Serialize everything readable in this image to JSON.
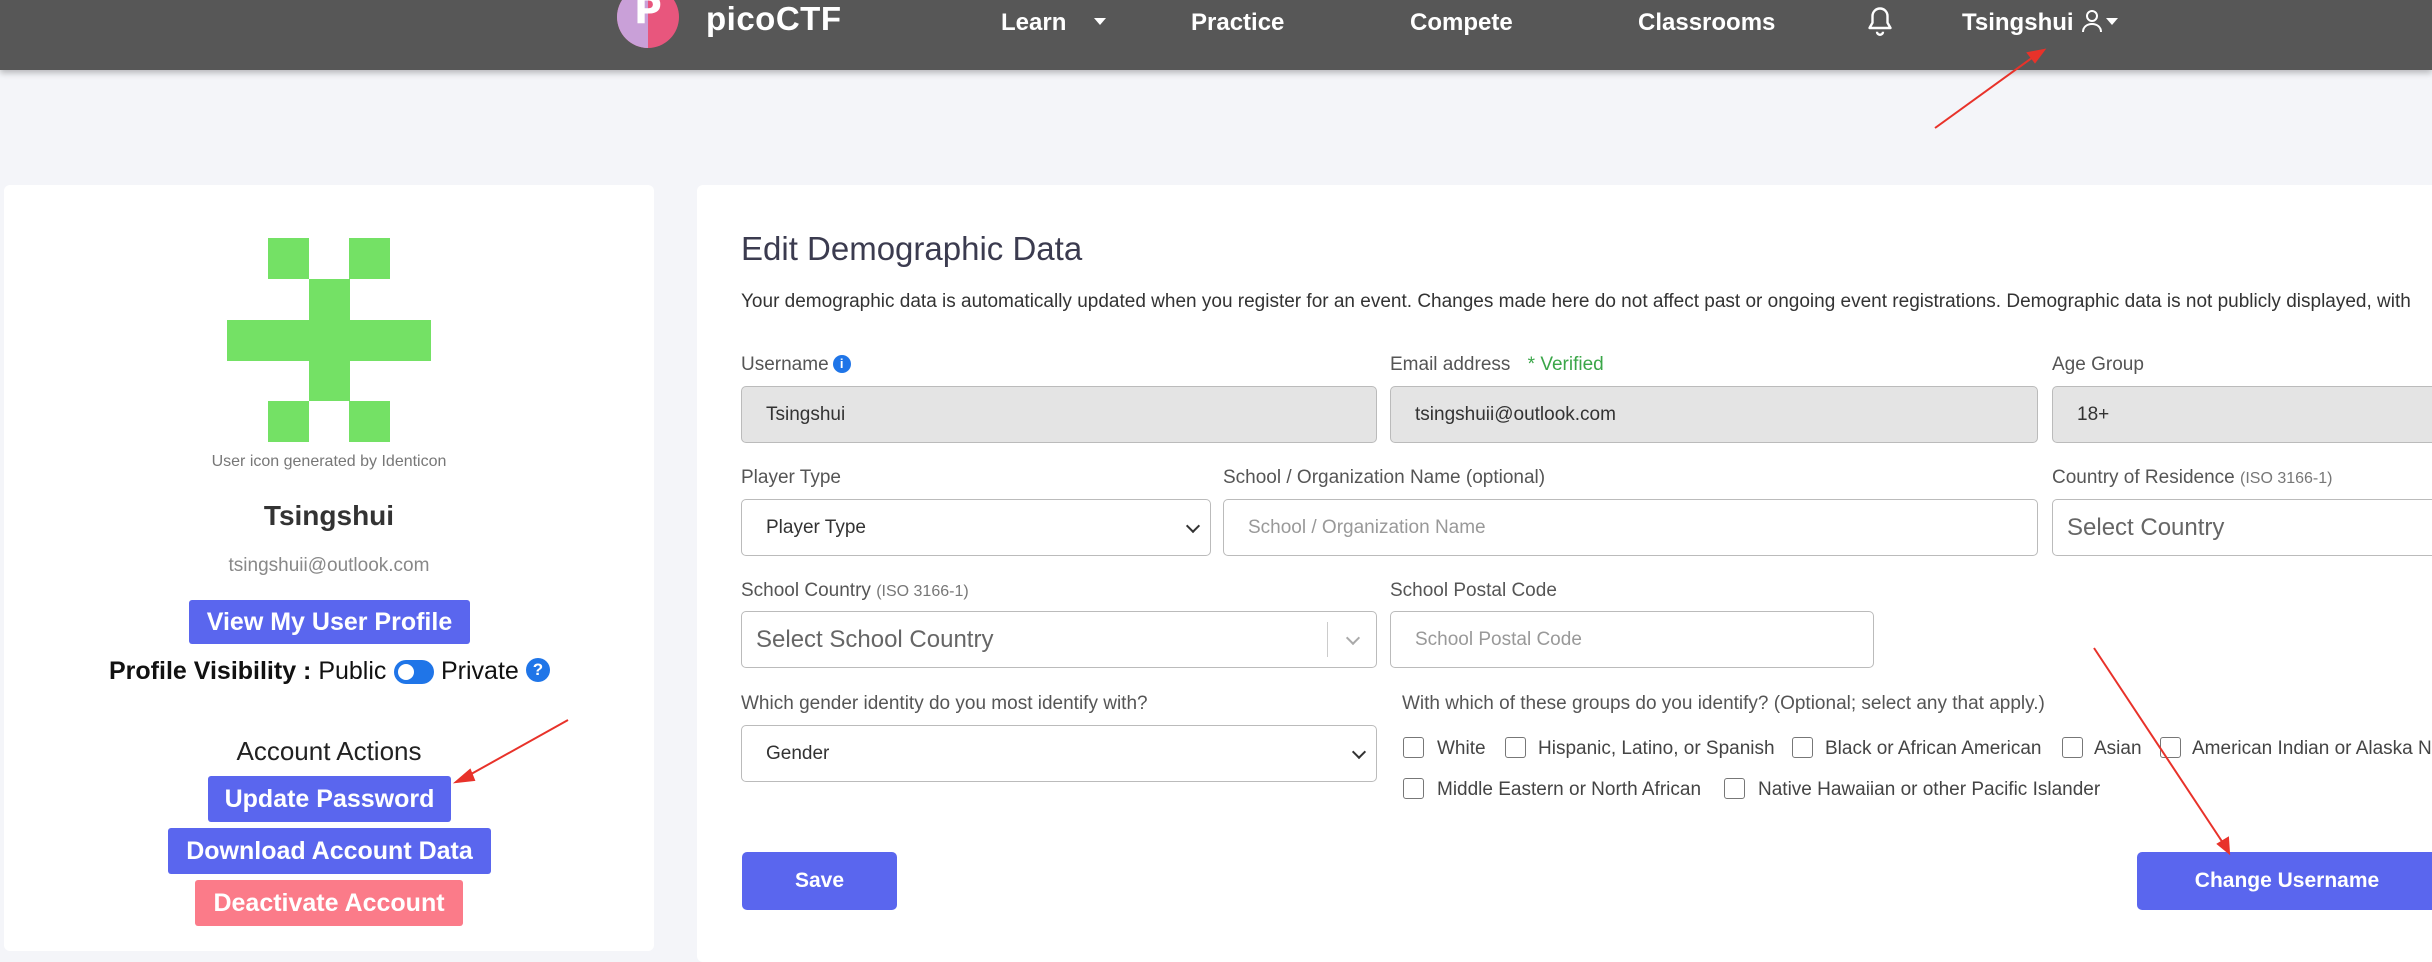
{
  "nav": {
    "brand": "picoCTF",
    "items": [
      {
        "label": "Learn"
      },
      {
        "label": "Practice"
      },
      {
        "label": "Compete"
      },
      {
        "label": "Classrooms"
      }
    ],
    "username": "Tsingshui"
  },
  "profile": {
    "identicon_caption": "User icon generated by Identicon",
    "identicon_color": "#74e165",
    "username": "Tsingshui",
    "email": "tsingshuii@outlook.com",
    "view_profile_label": "View My User Profile",
    "visibility_label": "Profile Visibility :",
    "visibility_public": "Public",
    "visibility_private": "Private",
    "visibility_help": "?",
    "account_actions_title": "Account Actions",
    "update_password_label": "Update Password",
    "download_data_label": "Download Account Data",
    "deactivate_label": "Deactivate Account"
  },
  "form": {
    "title": "Edit Demographic Data",
    "description": "Your demographic data is automatically updated when you register for an event. Changes made here do not affect past or ongoing event registrations. Demographic data is not publicly displayed, with",
    "username_label": "Username",
    "username_value": "Tsingshui",
    "email_label": "Email address",
    "email_verified": "* Verified",
    "email_value": "tsingshuii@outlook.com",
    "age_label": "Age Group",
    "age_value": "18+",
    "player_type_label": "Player Type",
    "player_type_value": "Player Type",
    "school_name_label": "School / Organization Name (optional)",
    "school_name_placeholder": "School / Organization Name",
    "country_label": "Country of Residence",
    "country_label_note": "(ISO 3166-1)",
    "country_placeholder": "Select Country",
    "school_country_label": "School Country",
    "school_country_note": "(ISO 3166-1)",
    "school_country_placeholder": "Select School Country",
    "postal_label": "School Postal Code",
    "postal_placeholder": "School Postal Code",
    "gender_label": "Which gender identity do you most identify with?",
    "gender_value": "Gender",
    "groups_label": "With which of these groups do you identify? (Optional; select any that apply.)",
    "groups": [
      "White",
      "Hispanic, Latino, or Spanish",
      "Black or African American",
      "Asian",
      "American Indian or Alaska N",
      "Middle Eastern or North African",
      "Native Hawaiian or other Pacific Islander"
    ],
    "save_label": "Save",
    "change_username_label": "Change Username"
  },
  "colors": {
    "accent": "#5a66ee",
    "danger": "#fb7b89",
    "navbar": "#575757",
    "annotation_arrow": "#e8322a"
  }
}
